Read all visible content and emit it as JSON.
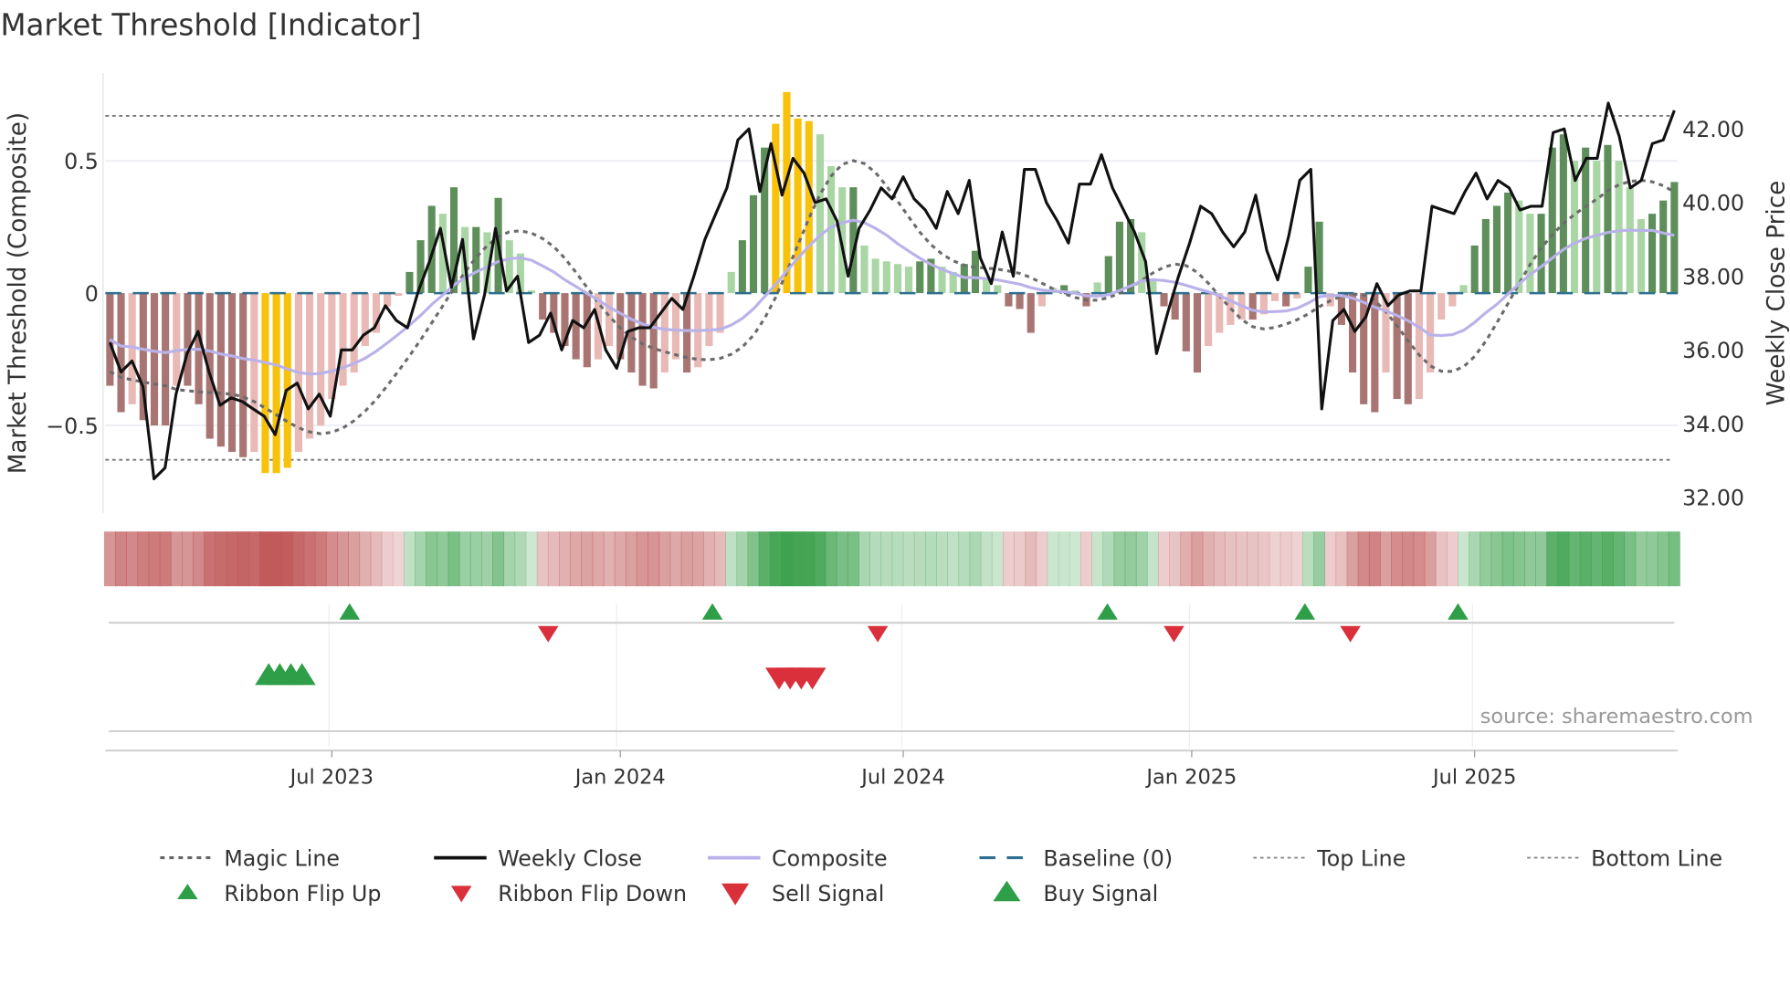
{
  "chart_data": {
    "type": "bar",
    "title": "Market Threshold [Indicator]",
    "ylabel": "Market Threshold (Composite)",
    "ylabel_right": "Weekly Close Price",
    "ylim": [
      -0.82,
      0.83
    ],
    "ylim_right": [
      31.6,
      43.5
    ],
    "yticks": [
      {
        "v": 0.5,
        "label": "0.5"
      },
      {
        "v": 0,
        "label": "0"
      },
      {
        "v": -0.5,
        "label": "−0.5"
      }
    ],
    "yticks_right": [
      {
        "v": 42,
        "label": "42.00"
      },
      {
        "v": 40,
        "label": "40.00"
      },
      {
        "v": 38,
        "label": "38.00"
      },
      {
        "v": 36,
        "label": "36.00"
      },
      {
        "v": 34,
        "label": "34.00"
      },
      {
        "v": 32,
        "label": "32.00"
      }
    ],
    "xticks": [
      {
        "week": 20,
        "label": "Jul 2023"
      },
      {
        "week": 46,
        "label": "Jan 2024"
      },
      {
        "week": 71.5,
        "label": "Jul 2024"
      },
      {
        "week": 97.5,
        "label": "Jan 2025"
      },
      {
        "week": 123,
        "label": "Jul 2025"
      }
    ],
    "top_line": 0.67,
    "bottom_line": -0.63,
    "composite_bars": [
      -0.35,
      -0.45,
      -0.42,
      -0.48,
      -0.5,
      -0.5,
      -0.35,
      -0.35,
      -0.42,
      -0.55,
      -0.58,
      -0.6,
      -0.62,
      -0.6,
      -0.68,
      -0.68,
      -0.66,
      -0.6,
      -0.55,
      -0.5,
      -0.4,
      -0.35,
      -0.3,
      -0.2,
      -0.15,
      -0.05,
      -0.01,
      0.08,
      0.2,
      0.33,
      0.3,
      0.4,
      0.25,
      0.25,
      0.23,
      0.36,
      0.2,
      0.15,
      0.01,
      -0.1,
      -0.15,
      -0.2,
      -0.25,
      -0.28,
      -0.25,
      -0.2,
      -0.25,
      -0.3,
      -0.35,
      -0.36,
      -0.3,
      -0.25,
      -0.3,
      -0.28,
      -0.2,
      -0.15,
      0.08,
      0.2,
      0.37,
      0.55,
      0.64,
      0.76,
      0.66,
      0.65,
      0.6,
      0.48,
      0.4,
      0.4,
      0.18,
      0.13,
      0.12,
      0.11,
      0.1,
      0.12,
      0.13,
      0.1,
      0.08,
      0.11,
      0.16,
      0.06,
      0.03,
      -0.05,
      -0.06,
      -0.15,
      -0.05,
      0.02,
      0.03,
      0.01,
      -0.05,
      0.04,
      0.14,
      0.27,
      0.28,
      0.23,
      0.05,
      -0.05,
      -0.1,
      -0.22,
      -0.3,
      -0.2,
      -0.15,
      -0.12,
      -0.1,
      -0.1,
      -0.08,
      -0.03,
      -0.05,
      -0.02,
      0.1,
      0.27,
      -0.05,
      -0.12,
      -0.3,
      -0.42,
      -0.45,
      -0.3,
      -0.4,
      -0.42,
      -0.4,
      -0.3,
      -0.1,
      -0.05,
      0.03,
      0.18,
      0.28,
      0.33,
      0.38,
      0.35,
      0.3,
      0.3,
      0.55,
      0.6,
      0.5,
      0.55,
      0.5,
      0.56,
      0.5,
      0.4,
      0.28,
      0.3,
      0.35,
      0.42
    ],
    "weekly_close": [
      36.2,
      35.4,
      35.7,
      35.0,
      32.5,
      32.8,
      34.8,
      35.9,
      36.5,
      35.4,
      34.5,
      34.7,
      34.6,
      34.4,
      34.2,
      33.7,
      34.9,
      35.1,
      34.4,
      34.8,
      34.2,
      36.0,
      36.0,
      36.4,
      36.6,
      37.2,
      36.8,
      36.6,
      37.6,
      38.4,
      39.3,
      37.7,
      39.0,
      36.3,
      37.5,
      39.3,
      37.6,
      38.0,
      36.2,
      36.4,
      37.0,
      36.0,
      36.8,
      36.6,
      37.1,
      36.0,
      35.5,
      36.5,
      36.6,
      36.6,
      37.0,
      37.4,
      37.1,
      38.0,
      39.0,
      39.7,
      40.4,
      41.7,
      42.0,
      40.3,
      41.6,
      40.2,
      41.2,
      40.8,
      40.0,
      40.1,
      39.5,
      38.0,
      39.3,
      39.8,
      40.4,
      40.1,
      40.7,
      40.1,
      39.8,
      39.3,
      40.3,
      39.7,
      40.6,
      38.5,
      37.8,
      39.2,
      38.0,
      40.9,
      40.9,
      40.0,
      39.5,
      38.9,
      40.5,
      40.5,
      41.3,
      40.4,
      39.8,
      39.2,
      38.4,
      35.9,
      37.0,
      38.0,
      38.9,
      39.9,
      39.7,
      39.2,
      38.8,
      39.2,
      40.2,
      38.7,
      37.9,
      39.1,
      40.6,
      40.9,
      34.4,
      36.8,
      37.1,
      36.5,
      36.9,
      37.8,
      37.2,
      37.5,
      37.6,
      37.6,
      39.9,
      39.8,
      39.7,
      40.3,
      40.8,
      40.1,
      40.6,
      40.4,
      39.8,
      39.9,
      39.9,
      41.9,
      42.0,
      40.6,
      41.2,
      41.2,
      42.7,
      41.8,
      40.4,
      40.6,
      41.6,
      41.7,
      42.5
    ],
    "ribbon_flip_up_weeks": [
      21.6,
      54.3,
      89.9,
      107.7,
      121.5
    ],
    "ribbon_flip_down_weeks": [
      39.5,
      69.2,
      95.9,
      111.8
    ],
    "buy_signal_weeks": [
      14,
      15,
      16,
      17
    ],
    "sell_signal_weeks": [
      60,
      61,
      62,
      63
    ],
    "legend_placement": "bottom",
    "legend": [
      {
        "key": "magic",
        "label": "Magic Line"
      },
      {
        "key": "close",
        "label": "Weekly Close"
      },
      {
        "key": "composite",
        "label": "Composite"
      },
      {
        "key": "baseline",
        "label": "Baseline (0)"
      },
      {
        "key": "top",
        "label": "Top Line"
      },
      {
        "key": "bottom",
        "label": "Bottom Line"
      },
      {
        "key": "flipup",
        "label": "Ribbon Flip Up"
      },
      {
        "key": "flipdown",
        "label": "Ribbon Flip Down"
      },
      {
        "key": "sell",
        "label": "Sell Signal"
      },
      {
        "key": "buy",
        "label": "Buy Signal"
      }
    ],
    "source": "source: sharemaestro.com",
    "colors": {
      "pos_dark": "#5e8f5a",
      "pos_light": "#a9d6a4",
      "neg_dark": "#a87572",
      "neg_light": "#e8b9b5",
      "extreme": "#f8c10a",
      "close": "#111111",
      "composite": "#b9b2ea",
      "magic": "#6b6b6b",
      "baseline": "#2f6f8f",
      "buy": "#2e9e48",
      "sell": "#d9303c"
    }
  }
}
